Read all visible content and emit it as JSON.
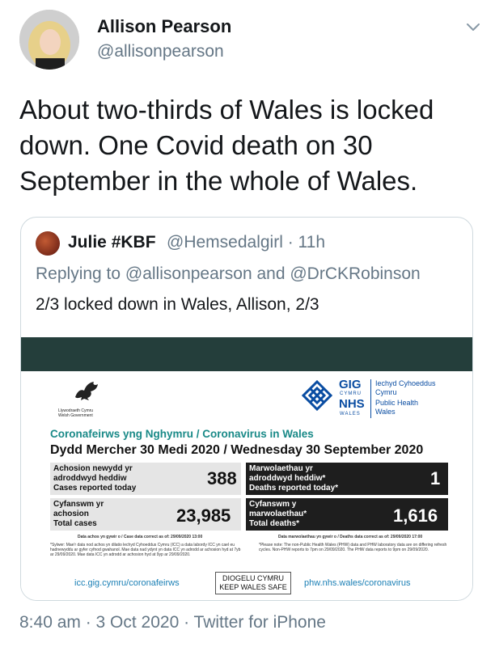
{
  "tweet": {
    "author_name": "Allison Pearson",
    "author_handle": "@allisonpearson",
    "text": "About two-thirds of Wales is locked down. One Covid death on 30 September in the whole of Wales.",
    "timestamp": "8:40 am · 3 Oct 2020 · Twitter for iPhone",
    "menu_icon": "chevron-down-icon"
  },
  "quoted": {
    "author_name": "Julie #KBF",
    "author_handle": "@Hemsedalgirl · 11h",
    "replying_to": "Replying to @allisonpearson and @DrCKRobinson",
    "text": "2/3 locked down in Wales, Allison, 2/3"
  },
  "graphic": {
    "header_bar_color": "#243e3b",
    "gov_logo": {
      "line1": "Llywodraeth Cymru",
      "line2": "Welsh Government"
    },
    "nhs_logo": {
      "gig": "GIG",
      "cymru": "CYMRU",
      "nhs": "NHS",
      "wales": "WALES",
      "line1": "Iechyd Cyhoeddus",
      "line2": "Cymru",
      "line3": "Public Health",
      "line4": "Wales"
    },
    "subtitle": "Coronafeirws yng Nghymru / Coronavirus in Wales",
    "date_title": "Dydd Mercher 30 Medi 2020 / Wednesday 30 September 2020",
    "stats": {
      "new_cases": {
        "label_cy_1": "Achosion newydd yr",
        "label_cy_2": "adroddwyd heddiw",
        "label_en": "Cases reported today",
        "value": "388"
      },
      "deaths_today": {
        "label_cy_1": "Marwolaethau yr",
        "label_cy_2": "adroddwyd heddiw*",
        "label_en": "Deaths reported today*",
        "value": "1"
      },
      "total_cases": {
        "label_cy_1": "Cyfanswm yr",
        "label_cy_2": "achosion",
        "label_en": "Total cases",
        "value": "23,985"
      },
      "total_deaths": {
        "label_cy_1": "Cyfanswm y",
        "label_cy_2": "marwolaethau*",
        "label_en": "Total deaths*",
        "value": "1,616"
      }
    },
    "data_correct_left": "Data achos yn gywir o / Case data correct as of: 29/09/2020 13:00",
    "data_correct_right": "Data marwolaethau yn gywir o / Deaths data correct as of: 29/09/2020 17:00",
    "footnote_left": "*Sylwer: Mae'r data nod achos yn dilatio lechyd Cyhoeddus Cymru (ICC) a data labordy ICC yn cael eu hadnewyddu ar gyfer cyfnod gwahanol. Mae data nad ydynt yn data ICC yn adrodd ar achosion hyd at 7yb ar 29/09/2020. Mae data ICC yn adrodd ar achosion hyd at 9yp ar 29/09/2020.",
    "footnote_right": "*Please note: The non-Public Health Wales (PHW) data and PHW laboratory data are on differing refresh cycles. Non-PHW reports to 7pm on 29/09/2020. The PHW data reports to 9pm on 29/09/2020.",
    "url_left": "icc.gig.cymru/coronafeirws",
    "url_right": "phw.nhs.wales/coronavirus",
    "keep_safe_1": "DIOGELU CYMRU",
    "keep_safe_2": "KEEP WALES SAFE"
  }
}
